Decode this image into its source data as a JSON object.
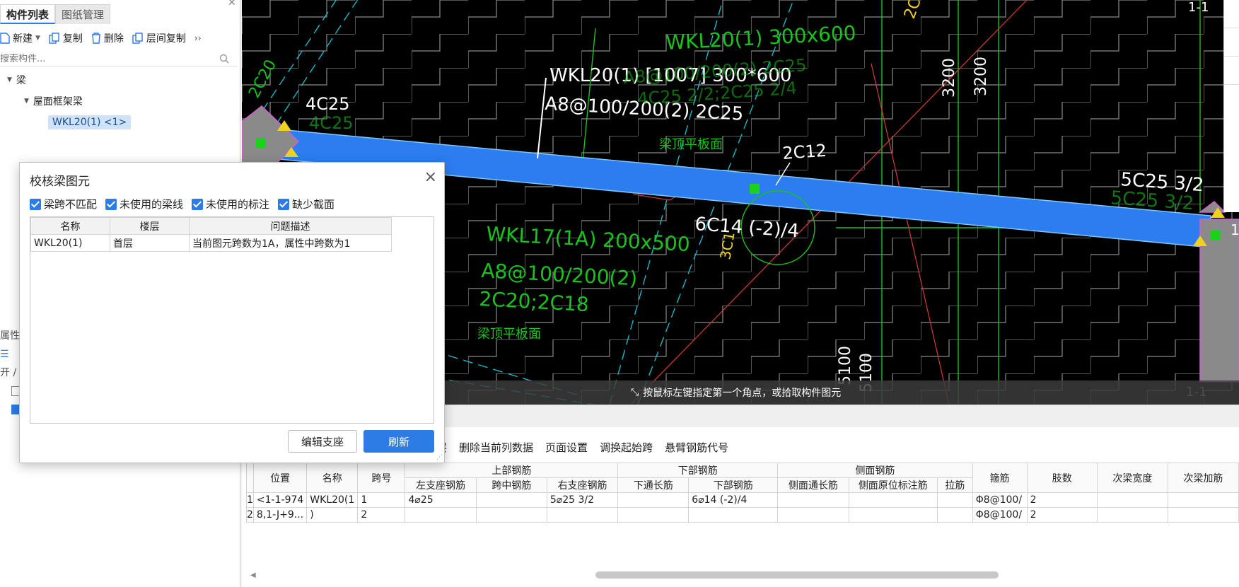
{
  "left_panel": {
    "tabs": [
      "构件列表",
      "图纸管理"
    ],
    "toolbar": {
      "new": "新建",
      "copy": "复制",
      "delete": "删除",
      "floor_copy": "层间复制",
      "more": "››"
    },
    "search_placeholder": "搜索构件...",
    "tree": {
      "root": "梁",
      "group": "屋面框架梁",
      "item": "WKL20(1) <1>"
    },
    "lower_labels": [
      "属性",
      "",
      "开 /"
    ]
  },
  "cad": {
    "labels": {
      "wkl20_title": "WKL20(1) [1007] 300*600",
      "wkl20_stirrup": "A8@100/200(2) 2C25",
      "wkl20_green1": "WKL20(1) 300x600",
      "wkl20_green2": "A8@100/200(2) 2C25",
      "wkl20_green3": "4C25 2/2;2C25 2/4",
      "c4c25_white": "4C25",
      "c4c25_green": "4C25",
      "c2c20": "2C20",
      "c2c12": "2C12",
      "c6c14": "6C14 (-2)/4",
      "c5c25": "5C25 3/2",
      "c5c25_green": "5C25 3/2",
      "wkl17_1": "WKL17(1A) 200x500",
      "wkl17_2": "A8@100/200(2)",
      "wkl17_3": "2C20;2C18",
      "beam_top1": "梁顶平板面",
      "beam_top2": "梁顶平板面",
      "dim3200a": "3200",
      "dim3200b": "3200",
      "dim5100a": "5100",
      "dim5100b": "5100",
      "section_top": "1-1",
      "section_bottom": "1-1",
      "section_right": "1",
      "c2c": "2C",
      "c3c1": "3C1"
    },
    "hint": "按鼠标左键指定第一个角点，或拾取构件图元",
    "colors": {
      "beam": "#2b7df0",
      "green": "#19c21d",
      "cyan": "#16b9c9",
      "grid": "#8a8a8a"
    }
  },
  "dialog": {
    "title": "校核梁图元",
    "filters": [
      "梁跨不匹配",
      "未使用的梁线",
      "未使用的标注",
      "缺少截面"
    ],
    "columns": [
      "名称",
      "楼层",
      "问题描述"
    ],
    "rows": [
      {
        "name": "WKL20(1)",
        "floor": "首层",
        "desc": "当前图元跨数为1A，属性中跨数为1"
      }
    ],
    "buttons": {
      "edit": "编辑支座",
      "refresh": "刷新"
    }
  },
  "bottom": {
    "menu": [
      "层",
      "删除当前列数据",
      "页面设置",
      "调换起始跨",
      "悬臂钢筋代号"
    ],
    "header_groups": {
      "top": "上部钢筋",
      "bottom": "下部钢筋",
      "side": "侧面钢筋"
    },
    "columns": {
      "pos": "位置",
      "name": "名称",
      "span": "跨号",
      "left": "左支座钢筋",
      "mid": "跨中钢筋",
      "right": "右支座钢筋",
      "bot_through": "下通长筋",
      "bot": "下部钢筋",
      "side_through": "侧面通长筋",
      "side_orig": "侧面原位标注筋",
      "tie": "拉筋",
      "stirrup": "箍筋",
      "legs": "肢数",
      "sec_width": "次梁宽度",
      "sec_add": "次梁加筋"
    },
    "rows": [
      {
        "idx": "1",
        "pos": "<1-1-974",
        "name": "WKL20(1",
        "span": "1",
        "left": "4⌀25",
        "mid": "",
        "right": "5⌀25 3/2",
        "bot_through": "",
        "bot": "6⌀14 (-2)/4",
        "stirrup": "Φ8@100/",
        "legs": "2"
      },
      {
        "idx": "2",
        "pos": "8,1-J+9...",
        "name": ")",
        "span": "2",
        "left": "",
        "mid": "",
        "right": "",
        "bot_through": "",
        "bot": "",
        "stirrup": "Φ8@100/",
        "legs": "2"
      }
    ]
  }
}
